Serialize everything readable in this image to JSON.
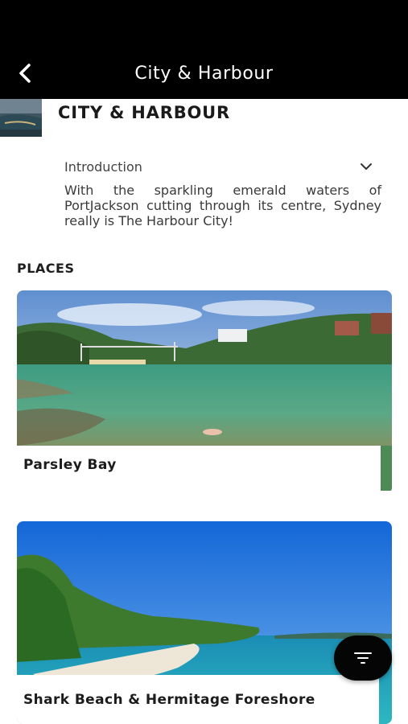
{
  "header": {
    "title": "City &  Harbour",
    "back_icon": "chevron-left-icon"
  },
  "section": {
    "title": "CITY &  HARBOUR"
  },
  "introduction": {
    "label": "Introduction",
    "toggle_icon": "chevron-down-icon",
    "text": "With the sparkling emerald waters of PortJackson cutting through its centre, Sydney really is The Harbour City!"
  },
  "places": {
    "heading": "PLACES",
    "items": [
      {
        "name": "Parsley Bay"
      },
      {
        "name": "Shark Beach & Hermitage Foreshore"
      }
    ]
  },
  "fab": {
    "icon": "filter-icon"
  },
  "colors": {
    "app_bar": "#000000",
    "background": "#ffffff",
    "fab": "#050505"
  }
}
